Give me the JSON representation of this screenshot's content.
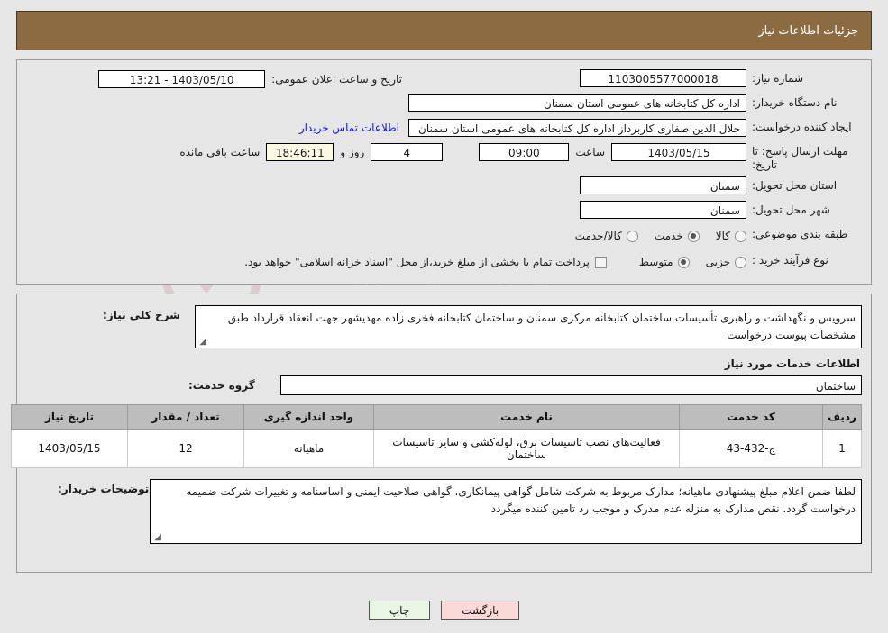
{
  "header": {
    "title": "جزئیات اطلاعات نیاز"
  },
  "watermark": {
    "line1": "AnaTender",
    "line2": ".net"
  },
  "form": {
    "need_number_label": "شماره نیاز:",
    "need_number_value": "1103005577000018",
    "announce_date_label": "تاریخ و ساعت اعلان عمومی:",
    "announce_date_value": "1403/05/10 - 13:21",
    "buyer_org_label": "نام دستگاه خریدار:",
    "buyer_org_value": "اداره کل کتابخانه های عمومی استان سمنان",
    "creator_label": "ایجاد کننده درخواست:",
    "creator_value": "جلال الدین صفاری کاربرداز اداره کل کتابخانه های عمومی استان سمنان",
    "contact_link": "اطلاعات تماس خریدار",
    "deadline_label": "مهلت ارسال پاسخ: تا تاریخ:",
    "deadline_date": "1403/05/15",
    "time_label": "ساعت",
    "deadline_time": "09:00",
    "days_value": "4",
    "days_label": "روز و",
    "countdown_value": "18:46:11",
    "countdown_label": "ساعت باقی مانده",
    "province_label": "استان محل تحویل:",
    "province_value": "سمنان",
    "city_label": "شهر محل تحویل:",
    "city_value": "سمنان",
    "category_label": "طبقه بندی موضوعی:",
    "category_options": [
      {
        "label": "کالا",
        "checked": false
      },
      {
        "label": "خدمت",
        "checked": true
      },
      {
        "label": "کالا/خدمت",
        "checked": false
      }
    ],
    "process_label": "نوع فرآیند خرید :",
    "process_options": [
      {
        "label": "جزیی",
        "checked": false
      },
      {
        "label": "متوسط",
        "checked": true
      }
    ],
    "treasury_note": "پرداخت تمام یا بخشی از مبلغ خرید،از محل \"اسناد خزانه اسلامی\" خواهد بود."
  },
  "description": {
    "label": "شرح کلی نیاز:",
    "value": "سرویس و نگهداشت و راهبری تأسیسات ساختمان کتابخانه مرکزی سمنان و ساختمان کتابخانه فخری زاده مهدیشهر جهت انعقاد قرارداد طبق مشخصات پیوست درخواست"
  },
  "services_section": {
    "title": "اطلاعات خدمات مورد نیاز",
    "group_label": "گروه خدمت:",
    "group_value": "ساختمان",
    "columns": [
      "ردیف",
      "کد خدمت",
      "نام خدمت",
      "واحد اندازه گیری",
      "تعداد / مقدار",
      "تاریخ نیاز"
    ],
    "rows": [
      {
        "radif": "1",
        "code": "ج-432-43",
        "name": "فعالیت‌های نصب تاسیسات برق، لوله‌کشی و سایر تاسیسات ساختمان",
        "unit": "ماهیانه",
        "qty": "12",
        "date": "1403/05/15"
      }
    ]
  },
  "notes": {
    "label": "توضیحات خریدار:",
    "value": "لطفا ضمن اعلام مبلغ پیشنهادی ماهیانه؛ مدارک مربوط به شرکت شامل گواهی پیمانکاری، گواهی صلاحیت ایمنی و اساسنامه و تغییرات شرکت ضمیمه درخواست گردد. نقص مدارک به منزله عدم مدرک و موجب رد تامین کننده میگردد"
  },
  "footer": {
    "print_label": "چاپ",
    "return_label": "بازگشت"
  },
  "colors": {
    "header_brown": "#8d6b42",
    "link_blue": "#1616c8",
    "print_green": "#e9f6e4",
    "return_pink": "#fbd9d7",
    "table_header_gray": "#bdbdbd",
    "countdown_cream": "#fbf8e3"
  }
}
